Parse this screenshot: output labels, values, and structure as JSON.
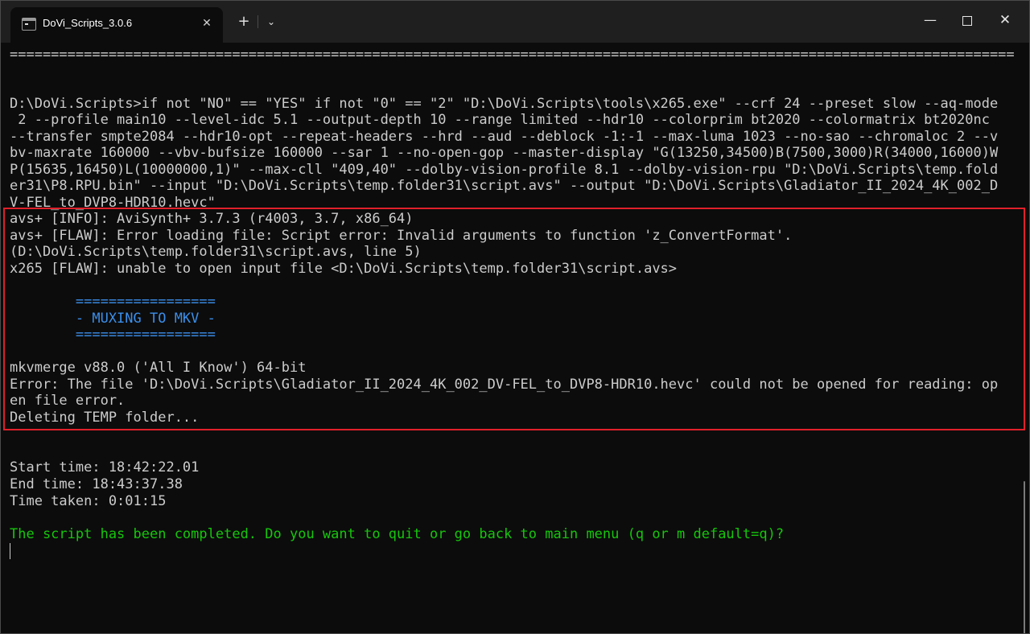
{
  "tab": {
    "title": "DoVi_Scripts_3.0.6",
    "close": "✕",
    "new_tab": "+",
    "dropdown": "⌄"
  },
  "window_controls": {
    "minimize": "—",
    "close": "✕"
  },
  "terminal": {
    "lines": [
      "==========================================================================================================================",
      "",
      "",
      "D:\\DoVi.Scripts>if not \"NO\" == \"YES\" if not \"0\" == \"2\" \"D:\\DoVi.Scripts\\tools\\x265.exe\" --crf 24 --preset slow --aq-mode",
      " 2 --profile main10 --level-idc 5.1 --output-depth 10 --range limited --hdr10 --colorprim bt2020 --colormatrix bt2020nc",
      "--transfer smpte2084 --hdr10-opt --repeat-headers --hrd --aud --deblock -1:-1 --max-luma 1023 --no-sao --chromaloc 2 --v",
      "bv-maxrate 160000 --vbv-bufsize 160000 --sar 1 --no-open-gop --master-display \"G(13250,34500)B(7500,3000)R(34000,16000)W",
      "P(15635,16450)L(10000000,1)\" --max-cll \"409,40\" --dolby-vision-profile 8.1 --dolby-vision-rpu \"D:\\DoVi.Scripts\\temp.fold",
      "er31\\P8.RPU.bin\" --input \"D:\\DoVi.Scripts\\temp.folder31\\script.avs\" --output \"D:\\DoVi.Scripts\\Gladiator_II_2024_4K_002_D",
      "V-FEL_to_DVP8-HDR10.hevc\"",
      "avs+ [INFO]: AviSynth+ 3.7.3 (r4003, 3.7, x86_64)",
      "avs+ [FLAW]: Error loading file: Script error: Invalid arguments to function 'z_ConvertFormat'.",
      "(D:\\DoVi.Scripts\\temp.folder31\\script.avs, line 5)",
      "x265 [FLAW]: unable to open input file <D:\\DoVi.Scripts\\temp.folder31\\script.avs>",
      "",
      "        =================",
      "        - MUXING TO MKV -",
      "        =================",
      "",
      "mkvmerge v88.0 ('All I Know') 64-bit",
      "Error: The file 'D:\\DoVi.Scripts\\Gladiator_II_2024_4K_002_DV-FEL_to_DVP8-HDR10.hevc' could not be opened for reading: op",
      "en file error.",
      "Deleting TEMP folder...",
      "",
      "",
      "Start time: 18:42:22.01",
      "End time: 18:43:37.38",
      "Time taken: 0:01:15",
      "",
      "The script has been completed. Do you want to quit or go back to main menu (q or m default=q)?"
    ],
    "colors": {
      "default": "#cccccc",
      "blue": "#3b8eea",
      "green": "#16c60c",
      "highlight_border": "#e0202a",
      "background": "#0c0c0c"
    }
  }
}
